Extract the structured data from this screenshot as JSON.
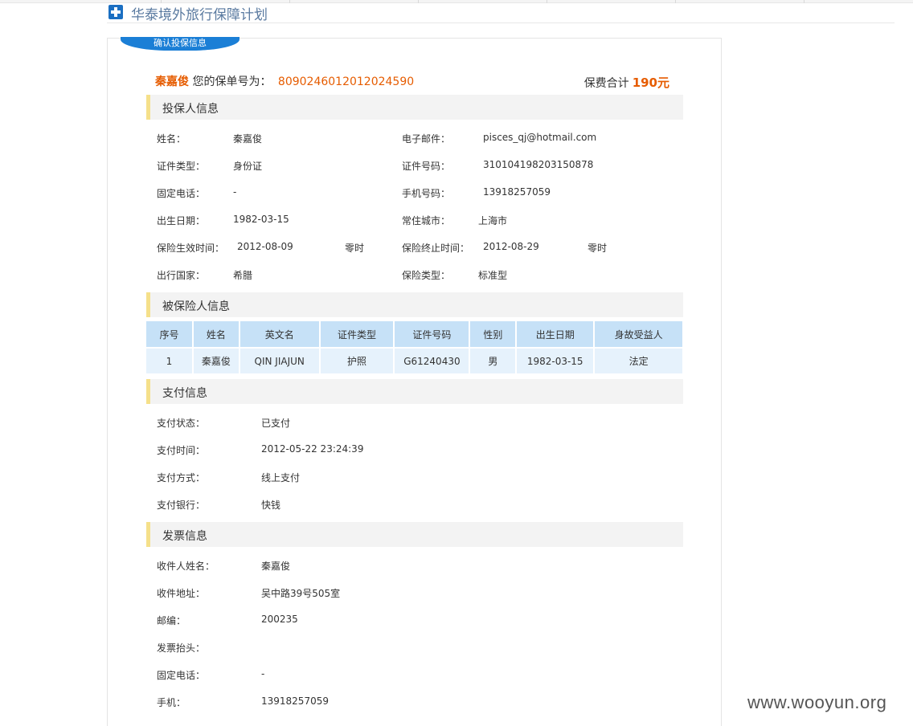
{
  "page_title": "华泰境外旅行保障计划",
  "tab_label": "确认投保信息",
  "policy": {
    "holder_name": "秦嘉俊",
    "policy_no_label": "您的保单号为：",
    "policy_no": "8090246012012024590",
    "total_label": "保费合计",
    "total_amount": "190元"
  },
  "sections": {
    "applicant": "投保人信息",
    "insured": "被保险人信息",
    "payment": "支付信息",
    "invoice": "发票信息"
  },
  "applicant": {
    "name_label": "姓名：",
    "name": "秦嘉俊",
    "email_label": "电子邮件：",
    "email": "pisces_qj@hotmail.com",
    "idtype_label": "证件类型：",
    "idtype": "身份证",
    "idno_label": "证件号码：",
    "idno": "310104198203150878",
    "phone_label": "固定电话：",
    "phone": "-",
    "mobile_label": "手机号码：",
    "mobile": "13918257059",
    "birth_label": "出生日期：",
    "birth": "1982-03-15",
    "city_label": "常住城市：",
    "city": "上海市",
    "start_label": "保险生效时间：",
    "start": "2012-08-09",
    "start_suffix": "零时",
    "end_label": "保险终止时间：",
    "end": "2012-08-29",
    "end_suffix": "零时",
    "country_label": "出行国家：",
    "country": "希腊",
    "plan_label": "保险类型：",
    "plan": "标准型"
  },
  "insured_table": {
    "headers": [
      "序号",
      "姓名",
      "英文名",
      "证件类型",
      "证件号码",
      "性别",
      "出生日期",
      "身故受益人"
    ],
    "rows": [
      [
        "1",
        "秦嘉俊",
        "QIN JIAJUN",
        "护照",
        "G61240430",
        "男",
        "1982-03-15",
        "法定"
      ]
    ]
  },
  "payment": {
    "status_label": "支付状态：",
    "status": "已支付",
    "time_label": "支付时间：",
    "time": "2012-05-22 23:24:39",
    "method_label": "支付方式：",
    "method": "线上支付",
    "bank_label": "支付银行：",
    "bank": "快钱"
  },
  "invoice": {
    "recipient_label": "收件人姓名：",
    "recipient": "秦嘉俊",
    "address_label": "收件地址：",
    "address": "吴中路39号505室",
    "zip_label": "邮编：",
    "zip": "200235",
    "title_label": "发票抬头：",
    "title": "",
    "phone_label": "固定电话：",
    "phone": "-",
    "mobile_label": "手机：",
    "mobile": "13918257059"
  },
  "watermark": "www.wooyun.org"
}
